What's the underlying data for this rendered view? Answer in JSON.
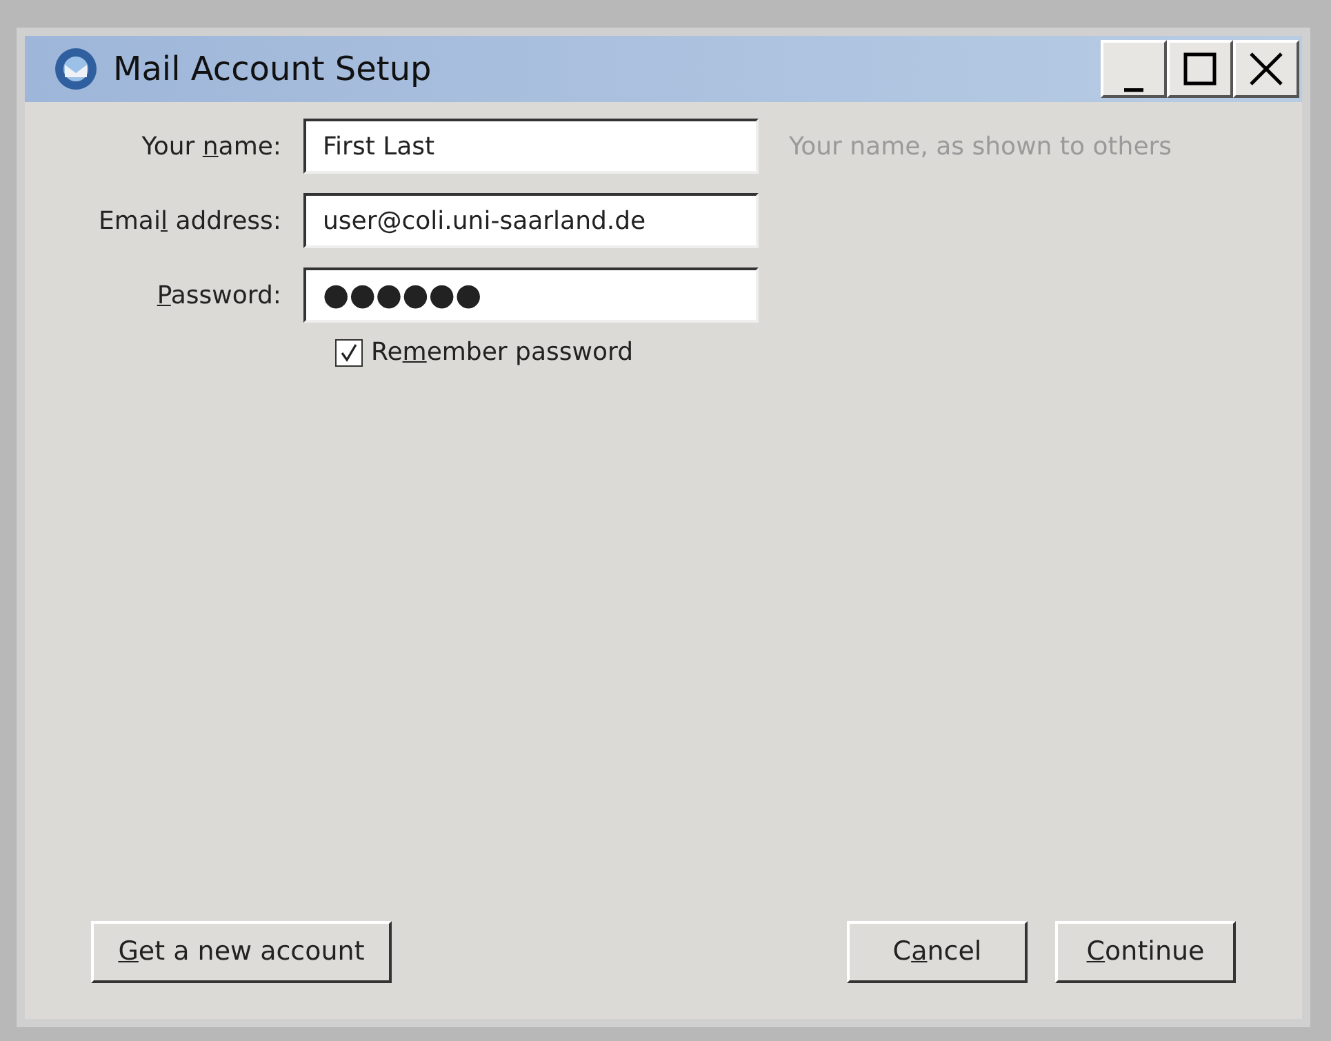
{
  "window": {
    "title": "Mail Account Setup",
    "controls": [
      {
        "kind": "minimize",
        "label": "_"
      },
      {
        "kind": "maximize"
      },
      {
        "kind": "close"
      }
    ]
  },
  "fields": [
    {
      "label": {
        "before": "Your ",
        "key": "n",
        "after": "ame:"
      },
      "value": "First Last",
      "hint": "Your name, as shown to others"
    },
    {
      "label": {
        "before": "Emai",
        "key": "l",
        "after": " address:"
      },
      "value": "user@coli.uni-saarland.de"
    },
    {
      "label": {
        "key": "P",
        "after": "assword:"
      },
      "value": "●●●●●●"
    }
  ],
  "remember_password": {
    "label": {
      "before": "Re",
      "key": "m",
      "after": "ember password"
    },
    "checked": true
  },
  "left_buttons": [
    {
      "label": {
        "key": "G",
        "after": "et a new account"
      }
    }
  ],
  "right_buttons": [
    {
      "label": {
        "before": "C",
        "key": "a",
        "after": "ncel"
      }
    },
    {
      "label": {
        "key": "C",
        "after": "ontinue"
      }
    }
  ]
}
